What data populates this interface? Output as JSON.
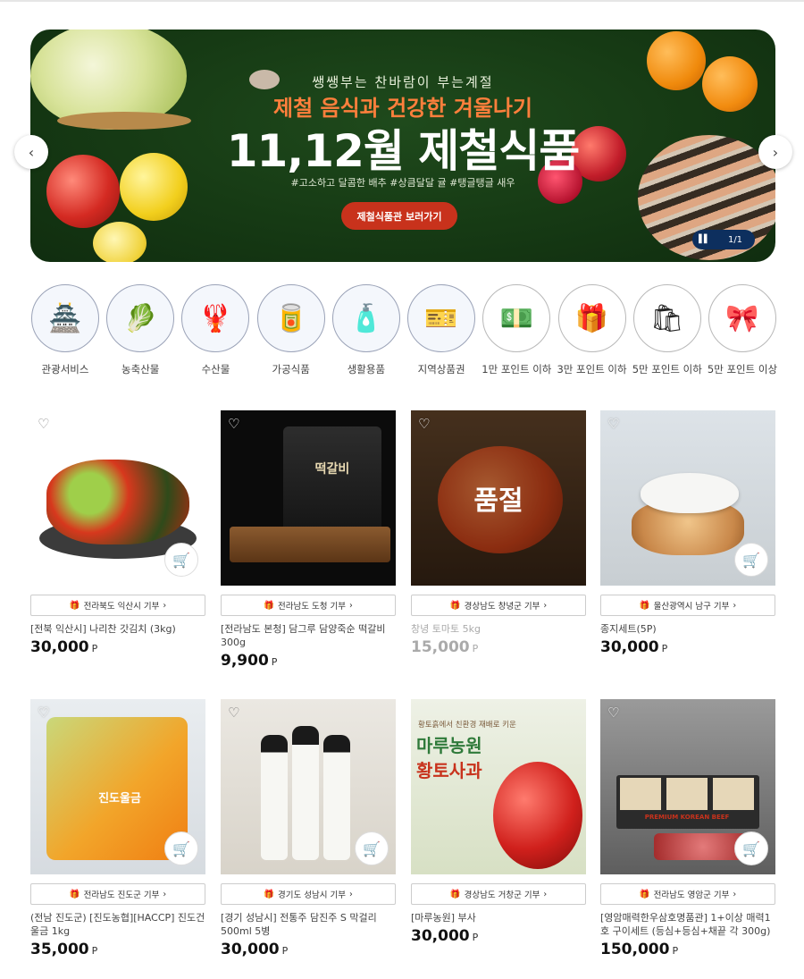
{
  "banner": {
    "subtitle": "쌩쌩부는 찬바람이 부는계절",
    "headline": "제철 음식과 건강한 겨울나기",
    "title": "11,12월 제철식품",
    "tags": "#고소하고 달콤한 배추   #상큼달달 귤   #탱글탱글 새우",
    "button_label": "제철식품관 보러가기",
    "pager": "1/1",
    "accent": "#c8321c",
    "background": "#163a14"
  },
  "categories": [
    {
      "label": "관광서비스",
      "icon": "tourism-icon",
      "glyph": "🏯"
    },
    {
      "label": "농축산물",
      "icon": "agriculture-icon",
      "glyph": "🥬"
    },
    {
      "label": "수산물",
      "icon": "seafood-icon",
      "glyph": "🦞"
    },
    {
      "label": "가공식품",
      "icon": "processed-food-icon",
      "glyph": "🥫"
    },
    {
      "label": "생활용품",
      "icon": "household-icon",
      "glyph": "🧴"
    },
    {
      "label": "지역상품권",
      "icon": "voucher-icon",
      "glyph": "🎫"
    },
    {
      "label": "1만 포인트 이하",
      "icon": "points-10k-icon",
      "glyph": "💵"
    },
    {
      "label": "3만 포인트 이하",
      "icon": "points-30k-icon",
      "glyph": "🎁"
    },
    {
      "label": "5만 포인트 이하",
      "icon": "points-50k-icon",
      "glyph": "🛍"
    },
    {
      "label": "5만 포인트 이상",
      "icon": "points-50k-plus-icon",
      "glyph": "🎀"
    }
  ],
  "products": [
    {
      "donate": "전라북도 익산시 기부",
      "name": "[전북 익산시] 나리찬 갓김치 (3kg)",
      "price": "30,000",
      "unit": "P",
      "sold_out": false
    },
    {
      "donate": "전라남도 도청 기부",
      "name": "[전라남도 본청] 담그루 담양죽순 떡갈비 300g",
      "price": "9,900",
      "unit": "P",
      "sold_out": false
    },
    {
      "donate": "경상남도 창녕군 기부",
      "name": "창녕 토마토 5kg",
      "price": "15,000",
      "unit": "P",
      "sold_out": true,
      "sold_label": "품절"
    },
    {
      "donate": "울산광역시 남구 기부",
      "name": "종지세트(5P)",
      "price": "30,000",
      "unit": "P",
      "sold_out": false
    },
    {
      "donate": "전라남도 진도군 기부",
      "name": "(전남 진도군) [진도농협][HACCP] 진도건울금 1kg",
      "price": "35,000",
      "unit": "P",
      "sold_out": false
    },
    {
      "donate": "경기도 성남시 기부",
      "name": "[경기 성남시] 전통주 담진주 S 막걸리 500ml 5병",
      "price": "30,000",
      "unit": "P",
      "sold_out": false
    },
    {
      "donate": "경상남도 거창군 기부",
      "name": "[마루농원] 부사",
      "price": "30,000",
      "unit": "P",
      "sold_out": false
    },
    {
      "donate": "전라남도 영암군 기부",
      "name": "[영암매력한우삼호명품관] 1+이상 매력1호 구이세트 (등심+등심+채끝 각 300g)",
      "price": "150,000",
      "unit": "P",
      "sold_out": false
    }
  ],
  "image_text": {
    "tteokgalbi_pack": "떡갈비",
    "apple_promo_top": "황토흙에서 친환경 재배로 키운",
    "apple_promo_brand": "마루농원",
    "apple_promo_title": "황토사과",
    "turmeric_pack": "진도울금",
    "beef_pack": "PREMIUM KOREAN BEEF"
  }
}
